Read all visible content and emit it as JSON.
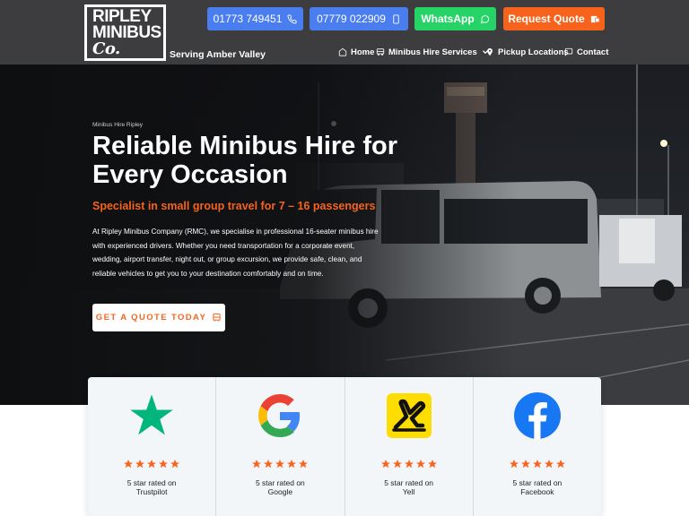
{
  "header": {
    "logo": {
      "line1": "RIPLEY",
      "line2": "MINIBUS",
      "line3": "Co."
    },
    "tagline": "Serving Amber Valley",
    "buttons": {
      "phone1": "01773 749451",
      "phone2": "07779 022909",
      "whatsapp": "WhatsApp",
      "quote": "Request Quote"
    },
    "nav": {
      "home": "Home",
      "services": "Minibus Hire Services",
      "pickup": "Pickup Locations",
      "contact": "Contact"
    }
  },
  "hero": {
    "eyebrow": "Minibus Hire Ripley",
    "title": "Reliable Minibus Hire for Every Occasion",
    "subtitle": "Specialist in small group travel for 7 – 16 passengers",
    "body": "At Ripley Minibus Company (RMC), we specialise in professional 16-seater minibus hire with experienced drivers. Whether you need transportation for a corporate event, wedding, airport transfer, night out, or group excursion, we provide safe, clean, and reliable vehicles to get you to your destination comfortably and on time.",
    "cta": "GET A QUOTE TODAY"
  },
  "reviews": [
    {
      "name": "trustpilot",
      "line1": "5 star rated on",
      "line2": "Trustpilot",
      "stars": 5,
      "color": "#00b67a"
    },
    {
      "name": "google",
      "line1": "5 star rated on",
      "line2": "Google",
      "stars": 5,
      "color": "#4285f4"
    },
    {
      "name": "yell",
      "line1": "5 star rated on",
      "line2": "Yell",
      "stars": 5,
      "color": "#ffdd00"
    },
    {
      "name": "facebook",
      "line1": "5 star rated on",
      "line2": "Facebook",
      "stars": 5,
      "color": "#1877f2"
    }
  ],
  "colors": {
    "header_bg": "#3d3d3f",
    "phone_btn": "#4a7df0",
    "whatsapp_btn": "#25d366",
    "accent_orange": "#f7631c",
    "star": "#f7631c"
  },
  "icons": {
    "phone": "phone-icon",
    "whatsapp": "whatsapp-icon",
    "quote": "quote-icon",
    "home": "home-icon",
    "bus": "bus-icon",
    "pin": "map-pin-icon",
    "chat": "chat-icon",
    "chevron": "chevron-down-icon"
  }
}
